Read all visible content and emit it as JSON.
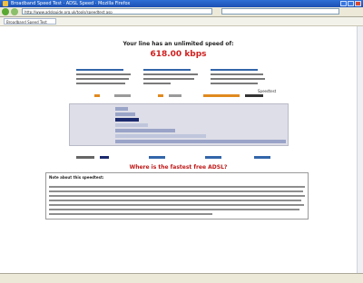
{
  "window": {
    "title": "Broadband Speed Test · ADSL Speed · Mozilla Firefox"
  },
  "toolbar": {
    "address": "http://www.adslguide.org.uk/tools/speedtest.asp"
  },
  "tab": {
    "label": "Broadband Speed Test"
  },
  "page": {
    "heading": "Your line has an unlimited speed of:",
    "speed_value": "618.00 kbps",
    "signature": "Speedtest",
    "promo": "Where is the fastest free ADSL?",
    "note_title": "Note about this speedtest:"
  },
  "colors": {
    "speed": "#d02020",
    "bar_main": "#1c2a6e",
    "bar_light": "#9aa4c8",
    "bar_pale": "#bfc6dc",
    "accent_orange": "#e08a1e",
    "link": "#3366aa"
  }
}
